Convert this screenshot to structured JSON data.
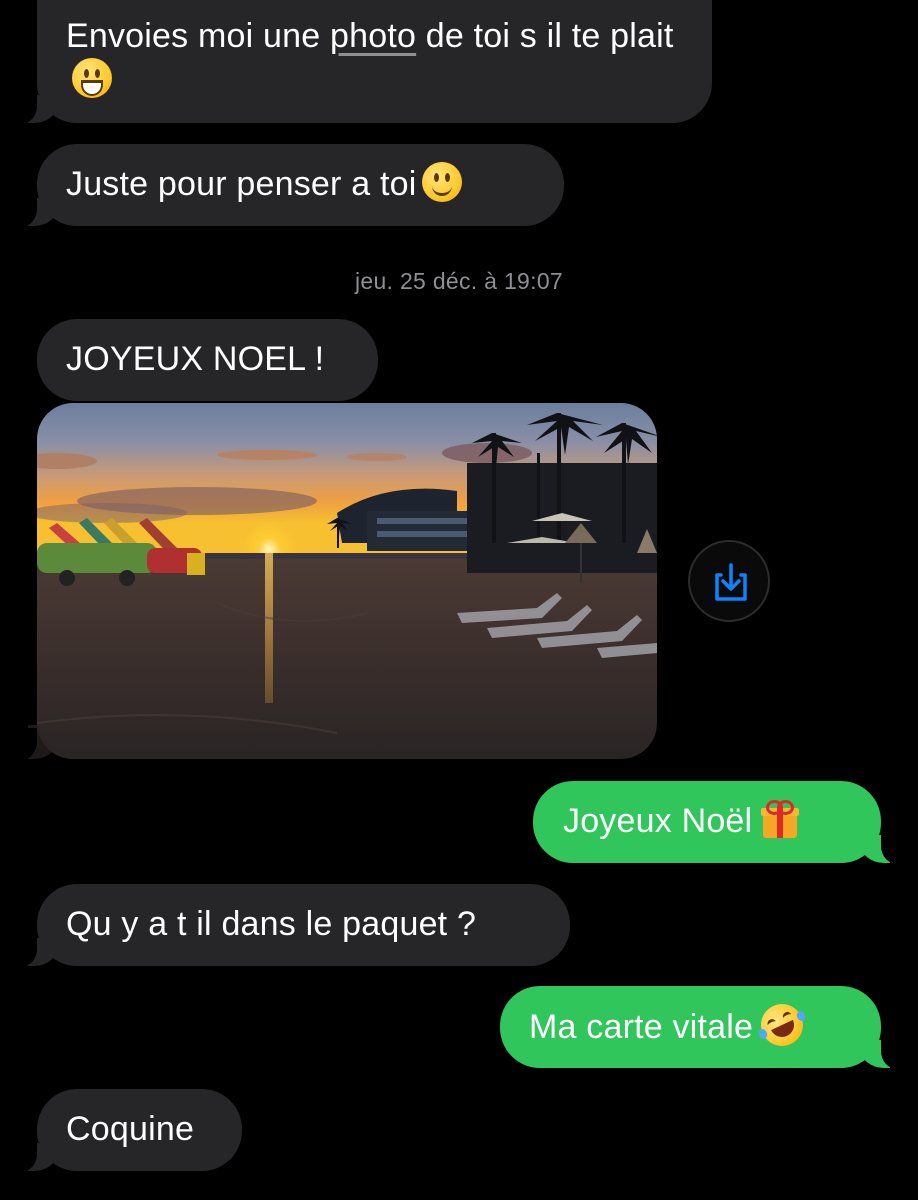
{
  "messages": [
    {
      "direction": "received",
      "text_before": "Envoies moi une ",
      "link_text": "photo",
      "text_after": " de toi s il te plait",
      "emoji": "grinning-face"
    },
    {
      "direction": "received",
      "text": "Juste pour penser a toi",
      "emoji": "slightly-smiling-face"
    },
    {
      "direction": "received",
      "text": "JOYEUX NOEL !"
    },
    {
      "direction": "received",
      "type": "photo",
      "photo_subject": "beach-sunset-photo"
    },
    {
      "direction": "sent",
      "text": "Joyeux Noël",
      "emoji": "wrapped-gift"
    },
    {
      "direction": "received",
      "text": "Qu y a t il dans le paquet ?"
    },
    {
      "direction": "sent",
      "text": "Ma carte vitale",
      "emoji": "rolling-on-floor-laughing"
    },
    {
      "direction": "received",
      "text": "Coquine"
    }
  ],
  "timestamp": "jeu. 25 déc. à 19:07",
  "save_button_icon": "save-to-photos-icon",
  "colors": {
    "background": "#000000",
    "received_bubble": "#262628",
    "sent_bubble": "#30c65b",
    "timestamp_text": "#8e8e93",
    "accent": "#0a84ff"
  }
}
